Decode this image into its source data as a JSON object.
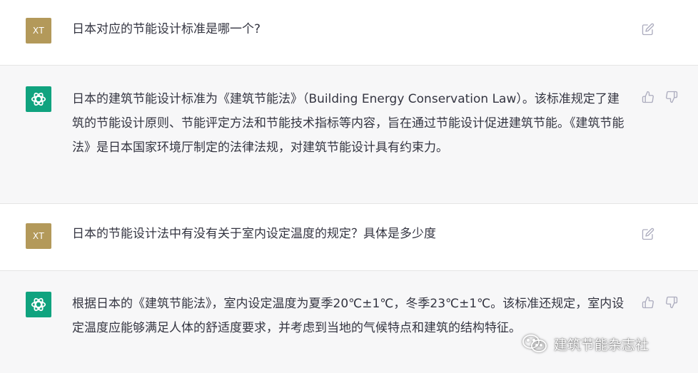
{
  "conversation": [
    {
      "role": "user",
      "avatar_text": "XT",
      "text": "日本对应的节能设计标准是哪一个?"
    },
    {
      "role": "assistant",
      "text": "日本的建筑节能设计标准为《建筑节能法》（Building Energy Conservation Law）。该标准规定了建筑的节能设计原则、节能评定方法和节能技术指标等内容，旨在通过节能设计促进建筑节能。《建筑节能法》是日本国家环境厅制定的法律法规，对建筑节能设计具有约束力。"
    },
    {
      "role": "user",
      "avatar_text": "XT",
      "text": "日本的节能设计法中有没有关于室内设定温度的规定？具体是多少度"
    },
    {
      "role": "assistant",
      "text": "根据日本的《建筑节能法》，室内设定温度为夏季20℃±1℃，冬季23℃±1℃。该标准还规定，室内设定温度应能够满足人体的舒适度要求，并考虑到当地的气候特点和建筑的结构特征。"
    }
  ],
  "icons": {
    "edit": "edit-icon",
    "thumbs_up": "thumbs-up-icon",
    "thumbs_down": "thumbs-down-icon",
    "assistant_logo": "openai-logo-icon",
    "watermark_logo": "wechat-icon"
  },
  "watermark": {
    "text": "建筑节能杂志社"
  },
  "colors": {
    "assistant_bg": "#f7f7f8",
    "user_avatar": "#b3995a",
    "assistant_avatar": "#10a37f",
    "text": "#343541",
    "icon": "#acacbe"
  }
}
